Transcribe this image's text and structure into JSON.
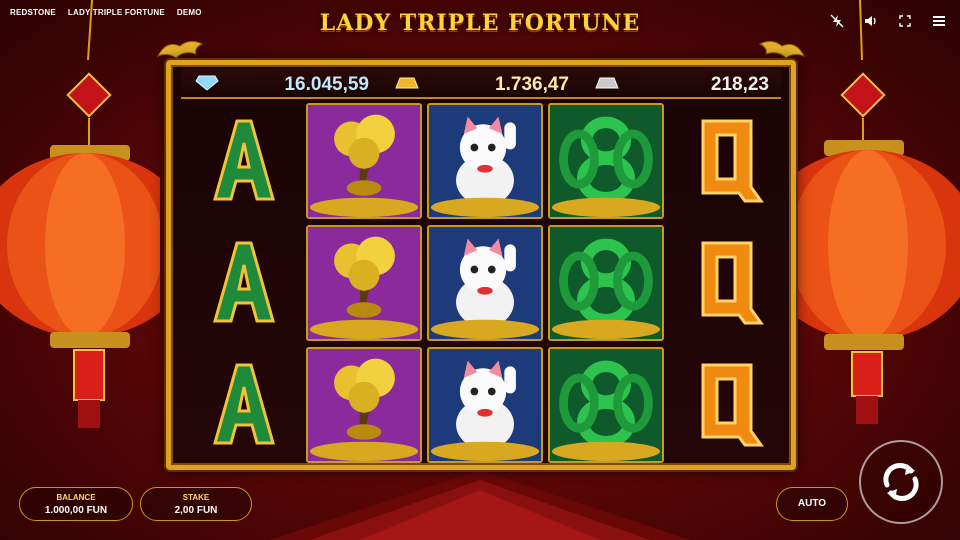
{
  "header": {
    "breadcrumbs": [
      "REDSTONE",
      "LADY TRIPLE FORTUNE",
      "DEMO"
    ],
    "title": "LADY TRIPLE FORTUNE",
    "icons": [
      "turbo-off-icon",
      "sound-icon",
      "fullscreen-icon",
      "menu-icon"
    ]
  },
  "jackpots": [
    {
      "type": "diamond",
      "value": "16.045,59"
    },
    {
      "type": "gold",
      "value": "1.736,47"
    },
    {
      "type": "silver",
      "value": "218,23"
    }
  ],
  "reels": [
    [
      "A",
      "A",
      "A"
    ],
    [
      "money-tree",
      "money-tree",
      "money-tree"
    ],
    [
      "lucky-cat",
      "lucky-cat",
      "lucky-cat"
    ],
    [
      "green-8",
      "green-8",
      "green-8"
    ],
    [
      "Q",
      "Q",
      "Q"
    ]
  ],
  "controls": {
    "balance_label": "BALANCE",
    "balance_value": "1.000,00 FUN",
    "stake_label": "STAKE",
    "stake_value": "2,00 FUN",
    "auto_label": "AUTO",
    "spin_icon": "spin-icon"
  },
  "colors": {
    "gold": "#e0a21c",
    "title_gold": "#ffd23a",
    "background_red": "#8a0d0d",
    "letter_green": "#1f8a3a",
    "letter_orange": "#f08a10"
  }
}
